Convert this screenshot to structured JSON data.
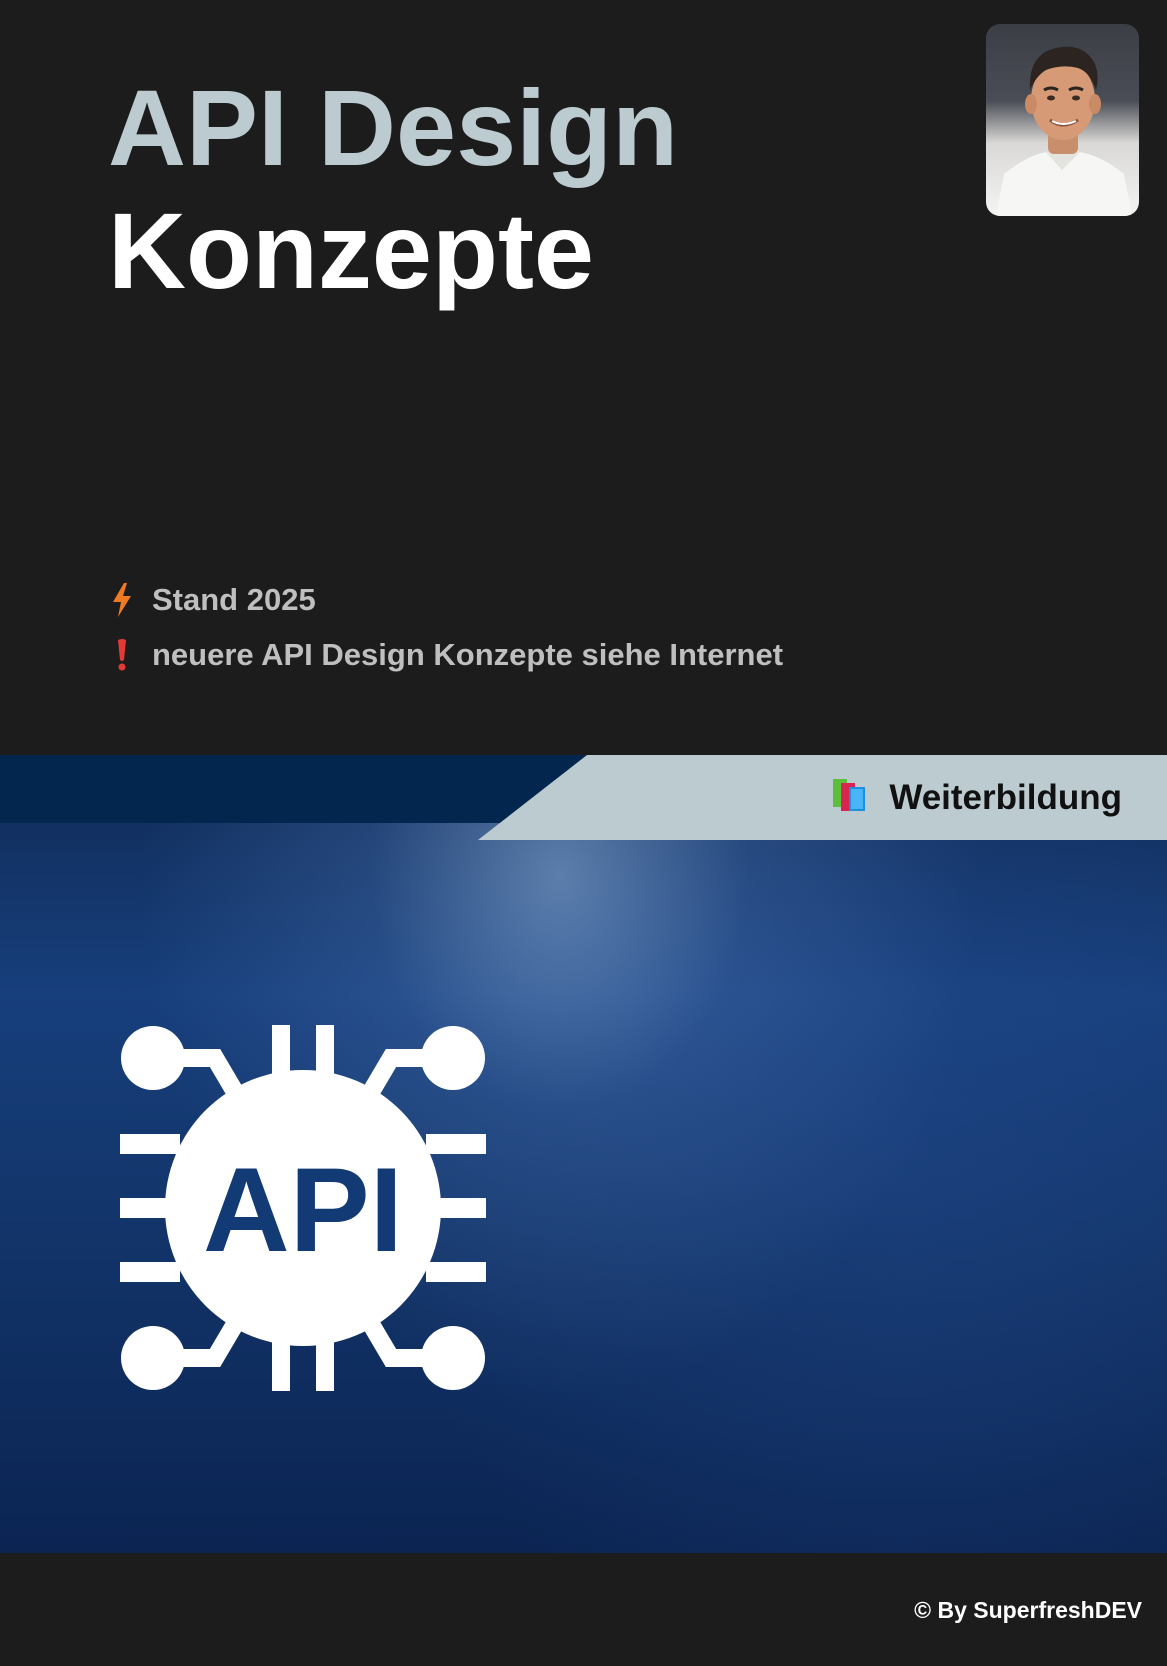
{
  "title": {
    "line1": "API Design",
    "line2": "Konzepte"
  },
  "avatar": {
    "icon": "author-photo"
  },
  "info": [
    {
      "icon": "lightning-icon",
      "text": "Stand 2025",
      "color": "#f07a22"
    },
    {
      "icon": "exclamation-icon",
      "text": "neuere API Design Konzepte siehe Internet",
      "color": "#e53935"
    }
  ],
  "banner": {
    "tab_label": "Weiterbildung",
    "tab_icon": "books-icon",
    "emblem_text": "API",
    "colors": {
      "tab_background": "#bccbd0",
      "strip": "#03264e",
      "emblem": "#ffffff",
      "background": "#173f7c"
    }
  },
  "footer": {
    "copyright": "© By SuperfreshDEV"
  }
}
